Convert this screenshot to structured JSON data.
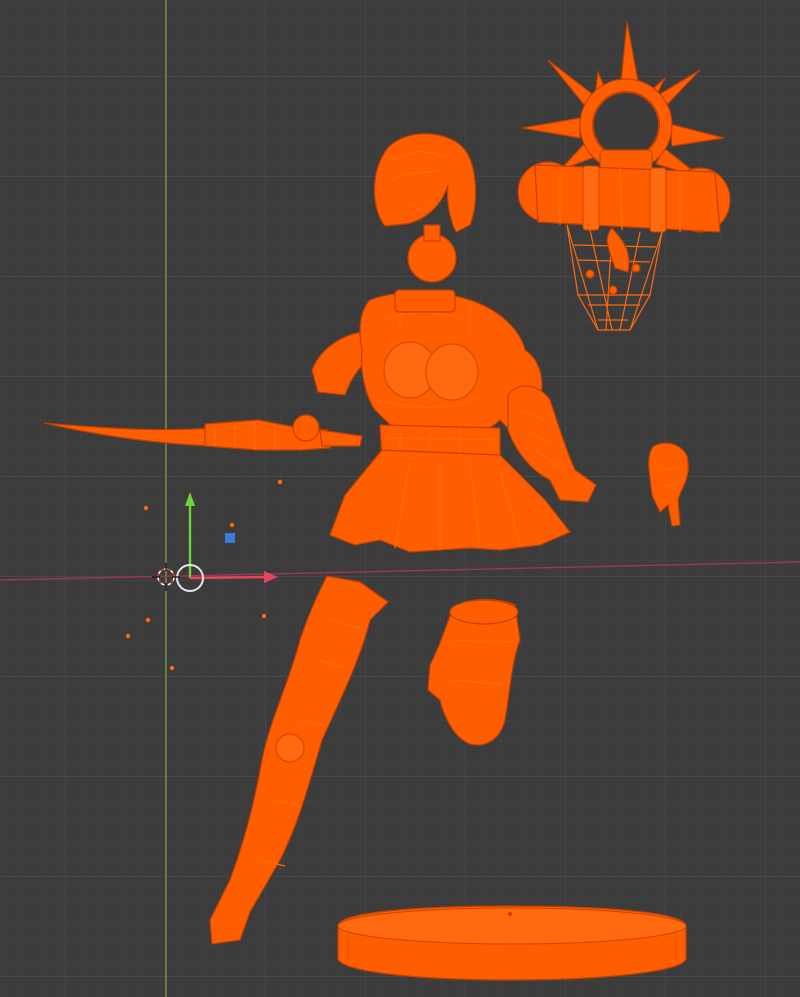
{
  "viewport": {
    "background_color": "#3c3c3c",
    "grid_minor_color": "#434343",
    "grid_major_color": "#4d4d4d",
    "x_axis_color": "#9b3a4a",
    "y_axis_color": "#6f9a3a",
    "selection_color": "#ff5e00"
  },
  "objects": [
    {
      "name": "head",
      "selected": true
    },
    {
      "name": "halo-backpack",
      "selected": true
    },
    {
      "name": "torso",
      "selected": true
    },
    {
      "name": "sword-arm",
      "selected": true
    },
    {
      "name": "left-hand",
      "selected": true
    },
    {
      "name": "left-leg",
      "selected": true
    },
    {
      "name": "right-leg",
      "selected": true
    },
    {
      "name": "base",
      "selected": true
    }
  ],
  "gizmo": {
    "icons": [
      "3d-cursor-icon",
      "move-gizmo-icon"
    ],
    "axis_colors": {
      "x": "#e8455e",
      "y": "#6fd43a",
      "z": "#3d7bd9"
    }
  }
}
